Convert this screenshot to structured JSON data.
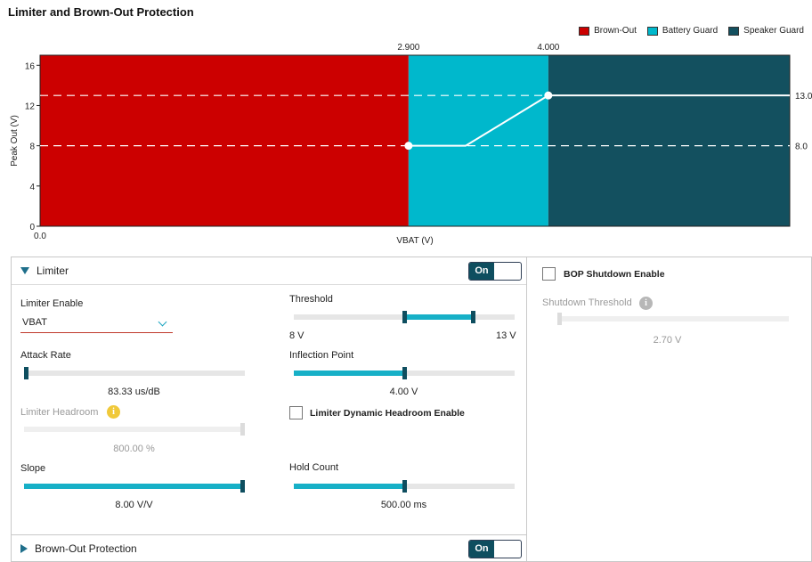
{
  "title": "Limiter and Brown-Out Protection",
  "legend": [
    {
      "label": "Brown-Out",
      "color": "#cc0000"
    },
    {
      "label": "Battery Guard",
      "color": "#00b8cc"
    },
    {
      "label": "Speaker Guard",
      "color": "#13505f"
    }
  ],
  "chart_data": {
    "type": "area",
    "xlabel": "VBAT (V)",
    "ylabel": "Peak Out (V)",
    "x_tick_labels": [
      "0.0"
    ],
    "yticks": [
      0,
      4,
      8,
      12,
      16
    ],
    "ylim": [
      0,
      17
    ],
    "regions": [
      {
        "name": "Brown-Out",
        "color": "#cc0000"
      },
      {
        "name": "Battery Guard",
        "color": "#00b8cc"
      },
      {
        "name": "Speaker Guard",
        "color": "#13505f"
      }
    ],
    "boundary_labels": [
      "2.900",
      "4.000"
    ],
    "right_labels": [
      "13.0",
      "8.0"
    ],
    "reference_lines_y": [
      13,
      8
    ],
    "curve_points": [
      {
        "x": 2.9,
        "y": 8
      },
      {
        "x": 3.35,
        "y": 8
      },
      {
        "x": 4.0,
        "y": 13
      },
      {
        "x": 5.9,
        "y": 13
      }
    ],
    "x_data_range": [
      0,
      5.9
    ],
    "markers_x": [
      2.9,
      4.0
    ]
  },
  "limiter": {
    "section_title": "Limiter",
    "toggle_label": "On",
    "enable_label": "Limiter Enable",
    "enable_value": "VBAT",
    "attack_rate_label": "Attack Rate",
    "attack_rate_value": "83.33 us/dB",
    "attack_rate_level": 0.0,
    "headroom_label": "Limiter Headroom",
    "headroom_value": "800.00 %",
    "headroom_level": 1.0,
    "slope_label": "Slope",
    "slope_value": "8.00 V/V",
    "slope_level": 1.0,
    "threshold_label": "Threshold",
    "threshold_min_label": "8 V",
    "threshold_max_label": "13 V",
    "threshold_range_level": [
      0.5,
      0.81
    ],
    "inflection_label": "Inflection Point",
    "inflection_value": "4.00 V",
    "inflection_level": 0.5,
    "dynamic_headroom_label": "Limiter Dynamic Headroom Enable",
    "hold_count_label": "Hold Count",
    "hold_count_value": "500.00 ms",
    "hold_count_level": 0.5
  },
  "bop": {
    "shutdown_enable_label": "BOP Shutdown Enable",
    "shutdown_threshold_label": "Shutdown Threshold",
    "shutdown_threshold_value": "2.70 V",
    "shutdown_threshold_level": 0.0,
    "section_title": "Brown-Out Protection",
    "toggle_label": "On"
  }
}
